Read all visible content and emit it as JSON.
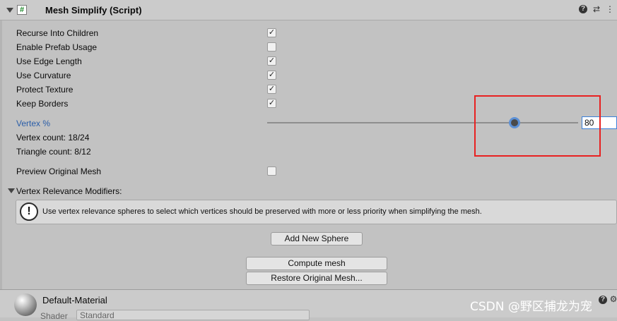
{
  "header": {
    "title": "Mesh Simplify (Script)",
    "script_glyph": "#",
    "icons": [
      "collapse-arrow-icon",
      "script-icon",
      "help-icon",
      "preset-icon",
      "context-menu-icon"
    ]
  },
  "options": [
    {
      "label": "Recurse Into Children",
      "checked": true
    },
    {
      "label": "Enable Prefab Usage",
      "checked": false
    },
    {
      "label": "Use Edge Length",
      "checked": true
    },
    {
      "label": "Use Curvature",
      "checked": true
    },
    {
      "label": "Protect Texture",
      "checked": true
    },
    {
      "label": "Keep Borders",
      "checked": true
    }
  ],
  "vertex_percent": {
    "label": "Vertex %",
    "value": "80",
    "slider_fraction": 0.8,
    "accent": "#2a5da8"
  },
  "stats": {
    "vertex_count": "Vertex count: 18/24",
    "triangle_count": "Triangle count: 8/12"
  },
  "preview": {
    "label": "Preview Original Mesh",
    "checked": false
  },
  "modifiers": {
    "label": "Vertex Relevance Modifiers:",
    "help_text": "Use vertex relevance spheres to select which vertices should be preserved with more or less priority when simplifying the mesh.",
    "help_glyph": "!"
  },
  "buttons": {
    "add_sphere": "Add New Sphere",
    "compute": "Compute mesh",
    "restore": "Restore Original Mesh..."
  },
  "material": {
    "name": "Default-Material",
    "shader_label": "Shader",
    "shader_value": "Standard"
  },
  "watermark": "CSDN @野区捕龙为宠",
  "colors": {
    "highlight_box": "#e82121",
    "slider_thumb_border": "#5d91d6"
  }
}
